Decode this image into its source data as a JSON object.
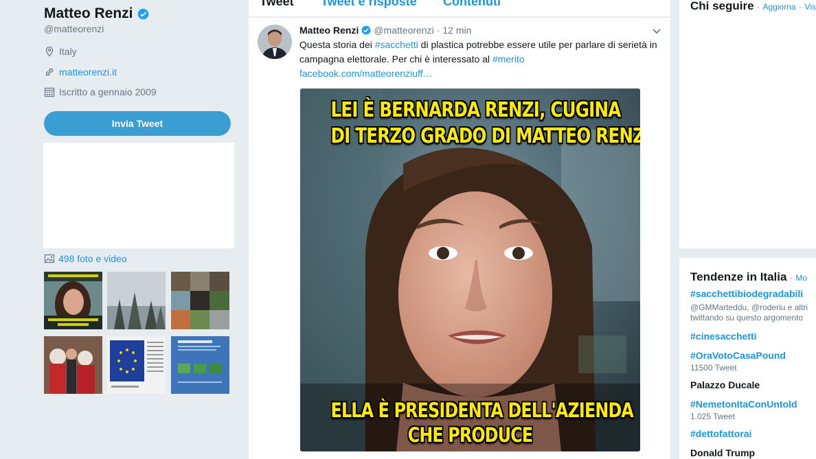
{
  "profile": {
    "name": "Matteo Renzi",
    "handle": "@matteorenzi",
    "location": "Italy",
    "website": "matteorenzi.it",
    "joined": "Iscritto a gennaio 2009",
    "tweet_button": "Invia Tweet",
    "media_count": "498 foto e video"
  },
  "tabs": {
    "tweet": "Tweet",
    "replies": "Tweet e risposte",
    "media": "Contenuti"
  },
  "tweet": {
    "author": "Matteo Renzi",
    "handle": "@matteorenzi",
    "separator": "·",
    "time": "12 min",
    "text_1": "Questa storia dei ",
    "hashtag_1": "#sacchetti",
    "text_2": " di plastica  potrebbe essere utile per parlare di serietà in campagna elettorale. Per chi è interessato al ",
    "hashtag_2": "#merito",
    "link": "facebook.com/matteorenziuff…",
    "image_top_line_1": "LEI È BERNARDA RENZI, CUGINA",
    "image_top_line_2": "DI TERZO GRADO DI MATTEO RENZI",
    "image_bottom_line_1": "ELLA È PRESIDENTA DELL'AZIENDA",
    "image_bottom_line_2": "CHE PRODUCE"
  },
  "who_to_follow": {
    "title": "Chi seguire",
    "separator": "·",
    "refresh": "Aggiorna",
    "separator_2": "·",
    "view_all": "Vis"
  },
  "trends": {
    "title": "Tendenze in Italia",
    "separator": "·",
    "change": "Mo",
    "items": [
      {
        "name": "#sacchettibiodegradabili",
        "sub": "@GMMarteddu, @roderiu e altri twittando su questo argomento"
      },
      {
        "name": "#cinesacchetti",
        "sub": ""
      },
      {
        "name": "#OraVotoCasaPound",
        "sub": "11500 Tweet"
      },
      {
        "name": "Palazzo Ducale",
        "sub": ""
      },
      {
        "name": "#NemetonItaConUntold",
        "sub": "1.025 Tweet"
      },
      {
        "name": "#dettofattorai",
        "sub": ""
      },
      {
        "name": "Donald Trump",
        "sub": ""
      }
    ]
  },
  "colors": {
    "background": "#e6ecf0",
    "accent": "#1b95e0",
    "button": "#3a9ed2",
    "caption": "#ffeb00"
  }
}
